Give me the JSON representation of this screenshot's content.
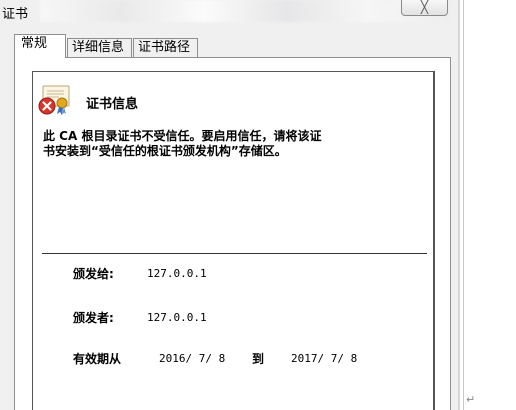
{
  "window": {
    "title": "证书",
    "close_label": "╳"
  },
  "tabs": [
    {
      "label": "常规",
      "active": true
    },
    {
      "label": "详细信息",
      "active": false
    },
    {
      "label": "证书路径",
      "active": false
    }
  ],
  "certificate": {
    "section_title": "证书信息",
    "icon": "certificate-error-icon",
    "warning_line1": "此 CA 根目录证书不受信任。要启用信任，请将该证",
    "warning_line2": "书安装到“受信任的根证书颁发机构”存储区。",
    "issued_to_label": "颁发给:",
    "issued_to_value": "127.0.0.1",
    "issued_by_label": "颁发者:",
    "issued_by_value": "127.0.0.1",
    "valid_label": "有效期从",
    "valid_from": "2016/ 7/ 8",
    "to_label": "到",
    "valid_to": "2017/ 7/ 8"
  },
  "footer_mark": "↵",
  "colors": {
    "dialog_bg": "#f0f0f0",
    "panel_bg": "#ffffff",
    "border": "#8e8f8f",
    "error_red": "#d9342b",
    "ribbon_gold": "#e0a81e"
  }
}
